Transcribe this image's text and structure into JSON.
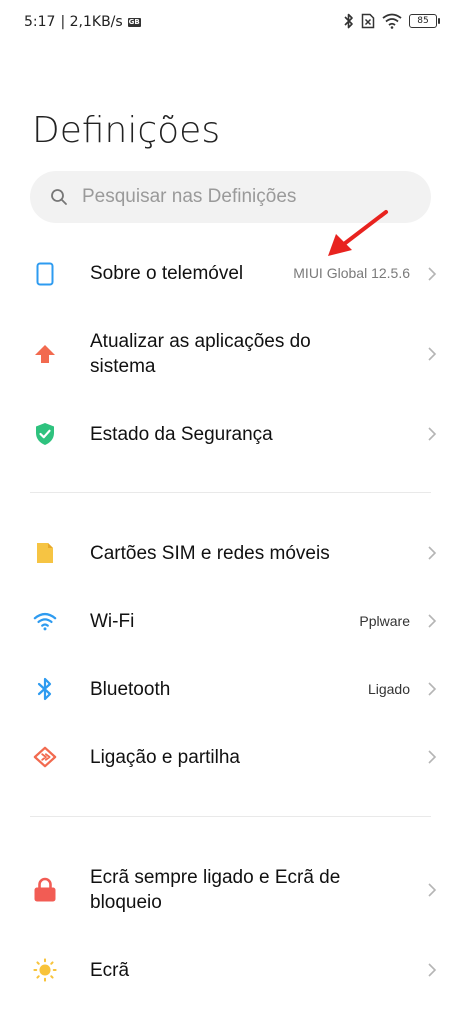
{
  "status_bar": {
    "time": "5:17",
    "network_speed": "| 2,1KB/s",
    "gallery_badge": "GB",
    "battery": "85"
  },
  "page_title": "Definições",
  "search": {
    "placeholder": "Pesquisar nas Definições"
  },
  "items": [
    {
      "label": "Sobre o telemóvel",
      "value": "MIUI Global 12.5.6",
      "icon": "phone-icon"
    },
    {
      "label": "Atualizar as aplicações do",
      "label2": "sistema",
      "value": "",
      "icon": "update-arrow-icon"
    },
    {
      "label": "Estado da Segurança",
      "value": "",
      "icon": "shield-check-icon"
    },
    {
      "label": "Cartões SIM e redes móveis",
      "value": "",
      "icon": "sim-card-icon"
    },
    {
      "label": "Wi-Fi",
      "value": "Pplware",
      "icon": "wifi-icon"
    },
    {
      "label": "Bluetooth",
      "value": "Ligado",
      "icon": "bluetooth-icon"
    },
    {
      "label": "Ligação e partilha",
      "value": "",
      "icon": "connection-sharing-icon"
    },
    {
      "label": "Ecrã sempre ligado e Ecrã de",
      "label2": "bloqueio",
      "value": "",
      "icon": "lock-icon"
    },
    {
      "label": "Ecrã",
      "value": "",
      "icon": "sun-icon"
    }
  ],
  "colors": {
    "accent_blue": "#2e9bf0",
    "update_orange": "#f26a4f",
    "security_green": "#2ec27e",
    "sim_yellow": "#f6c443",
    "lock_red": "#f25c54",
    "sun_yellow": "#f8c33a",
    "annotation_red": "#e8231f"
  }
}
